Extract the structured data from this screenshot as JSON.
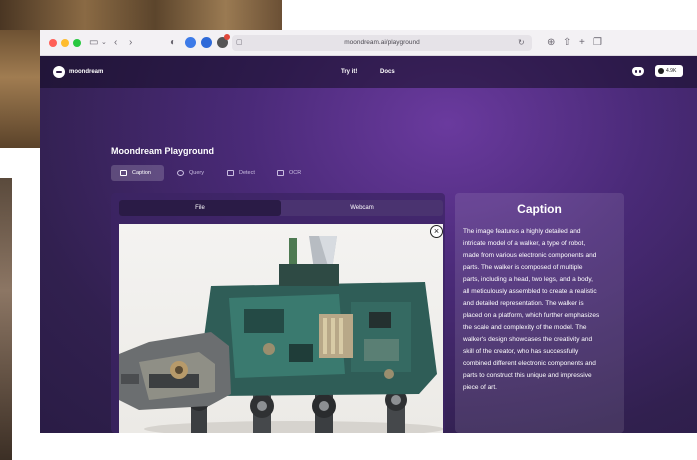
{
  "browser": {
    "url": "moondream.ai/playground"
  },
  "nav": {
    "brand": "moondream",
    "links": [
      "Try it!",
      "Docs"
    ],
    "github_count": "4.9K"
  },
  "page": {
    "title": "Moondream Playground",
    "modes": [
      "Caption",
      "Query",
      "Detect",
      "OCR"
    ],
    "active_mode": "Caption",
    "source_options": [
      "File",
      "Webcam"
    ],
    "active_source": "File"
  },
  "caption": {
    "heading": "Caption",
    "lines": [
      "The image features a highly detailed and",
      "intricate model of a walker, a type of robot,",
      "made from various electronic components and",
      "parts. The walker is composed of multiple",
      "parts, including a head, two legs, and a body,",
      "all meticulously assembled to create a realistic",
      "and detailed representation. The walker is",
      "placed on a platform, which further emphasizes",
      "the scale and complexity of the model. The",
      "walker's design showcases the creativity and",
      "skill of the creator, who has successfully",
      "combined different electronic components and",
      "parts to construct this unique and impressive",
      "piece of art."
    ]
  },
  "colors": {
    "page_bg": "#31204f",
    "panel": "#3c2464",
    "toggle_active": "#2a1b46",
    "traffic_red": "#ff5f57",
    "traffic_yellow": "#febc2e",
    "traffic_green": "#28c840"
  },
  "icons": [
    "sidebar-icon",
    "back-icon",
    "forward-icon",
    "shield-icon",
    "extension-icon",
    "lock-icon",
    "reload-icon",
    "download-icon",
    "share-icon",
    "new-tab-icon",
    "tabs-icon",
    "discord-icon",
    "github-icon",
    "close-icon"
  ]
}
